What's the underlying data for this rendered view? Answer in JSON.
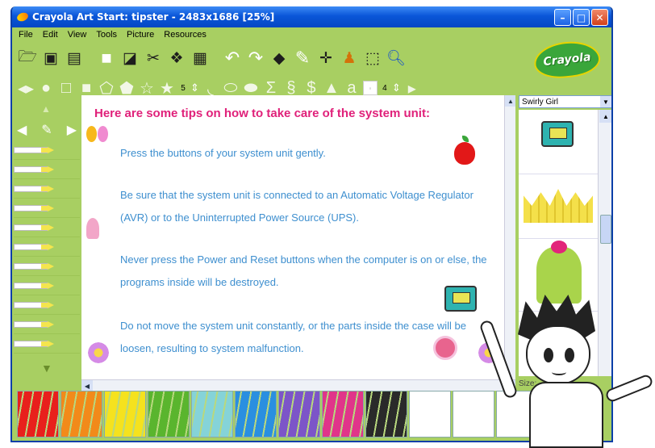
{
  "window": {
    "title": "Crayola Art Start: tipster - 2483x1686 [25%]",
    "buttons": {
      "minimize": "–",
      "maximize": "□",
      "close": "✕"
    }
  },
  "menu": [
    "File",
    "Edit",
    "View",
    "Tools",
    "Picture",
    "Resources"
  ],
  "toolbar": {
    "shape_size_value": "5",
    "text_size_value": "4"
  },
  "logo": {
    "text": "Crayola"
  },
  "canvas": {
    "heading": "Here are some tips on how to take care of the system unit:",
    "tips": [
      "Press the buttons of your system unit gently.",
      "Be sure that the system unit is connected to an Automatic Voltage Regulator",
      "(AVR) or to the Uninterrupted Power Source (UPS).",
      "Never press the Power and Reset buttons when the computer is on or else, the",
      "programs inside will be destroyed.",
      "Do not move the system unit constantly, or the parts inside the case will be",
      "loosen, resulting to system malfunction."
    ]
  },
  "sticker_panel": {
    "category": "Swirly Girl",
    "size_label": "Size:"
  },
  "palette": {
    "colors": [
      "#e8201c",
      "#f28a1a",
      "#f5e21e",
      "#5ab52e",
      "#85d3d8",
      "#2a8fe0",
      "#7c55c8",
      "#e0358a",
      "#2a2a2a",
      "#ffffff",
      "#ffffff",
      "#ffffff",
      "#f5a030"
    ]
  },
  "colors": {
    "frame_green": "#a8cf62",
    "heading_pink": "#e0217a",
    "tip_blue": "#3e8fcf",
    "titlebar_blue": "#0a56d8"
  }
}
